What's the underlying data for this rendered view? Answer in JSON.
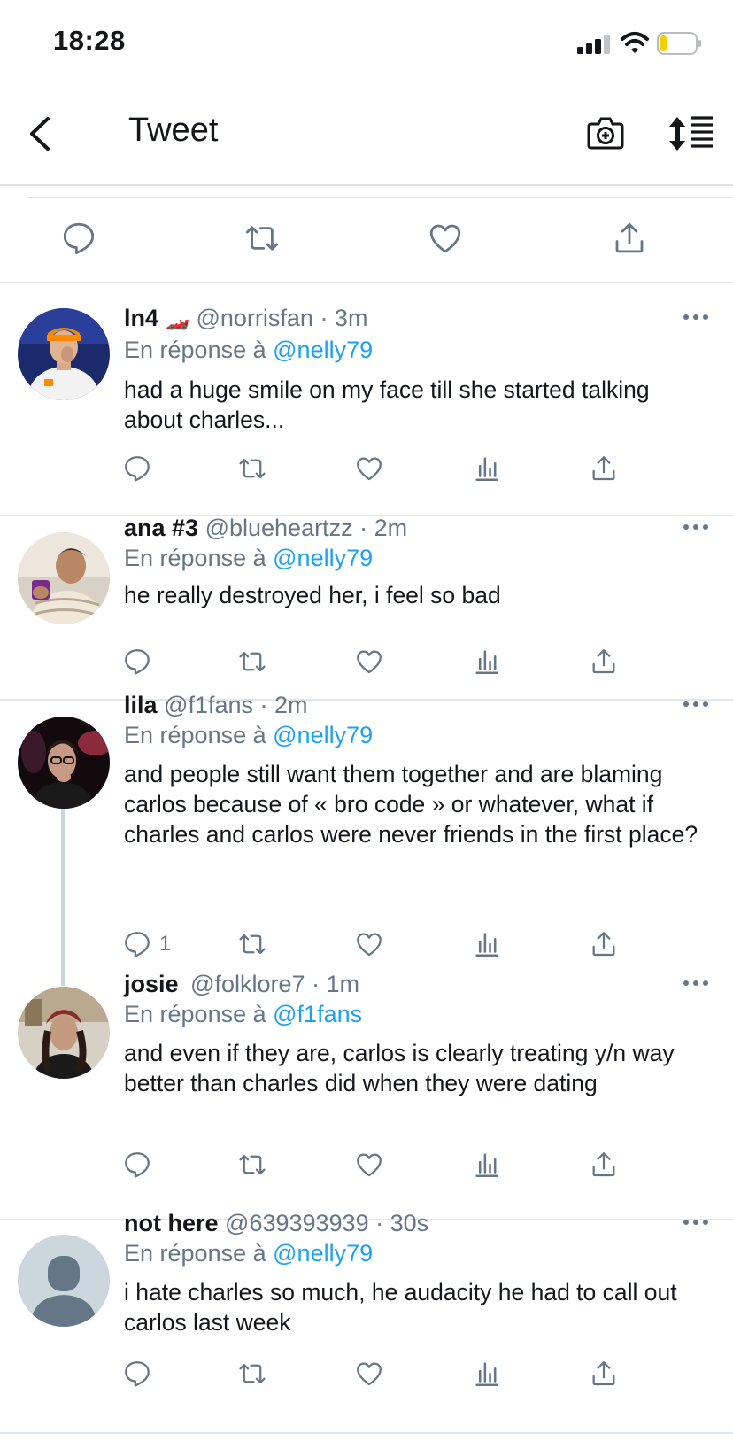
{
  "status_bar": {
    "time": "18:28"
  },
  "nav": {
    "title": "Tweet"
  },
  "replies": [
    {
      "name": "ln4",
      "emoji": "🏎️",
      "handle": "@norrisfan",
      "time": "· 3m",
      "reply_prefix": "En réponse à",
      "reply_to": "@nelly79",
      "text": "had a huge smile on my face till she started talking about charles...",
      "reply_count": ""
    },
    {
      "name": "ana #3",
      "emoji": "",
      "handle": "@blueheartzz",
      "time": "· 2m",
      "reply_prefix": "En réponse à",
      "reply_to": "@nelly79",
      "text": "he really destroyed her, i feel so bad",
      "reply_count": ""
    },
    {
      "name": "lila",
      "emoji": "",
      "handle": "@f1fans",
      "time": "· 2m",
      "reply_prefix": "En réponse à",
      "reply_to": "@nelly79",
      "text": "and people still want them together and are blaming carlos because of « bro code » or whatever, what if charles and carlos were never friends in the first place?",
      "reply_count": "1"
    },
    {
      "name": "josie",
      "emoji": "",
      "handle": "@folklore7",
      "time": "· 1m",
      "reply_prefix": "En réponse à",
      "reply_to": "@f1fans",
      "text": "and even if they are, carlos is clearly treating y/n way better than charles did when they were dating",
      "reply_count": ""
    },
    {
      "name": "not here",
      "emoji": "",
      "handle": "@639393939",
      "time": "· 30s",
      "reply_prefix": "En réponse à",
      "reply_to": "@nelly79",
      "text": "i hate charles so much, he audacity he had to call out carlos last week",
      "reply_count": ""
    }
  ],
  "icons": {
    "reply": "reply-icon",
    "retweet": "retweet-icon",
    "like": "heart-icon",
    "analytics": "analytics-icon",
    "share": "share-icon",
    "more": "more-icon"
  },
  "colors": {
    "accent": "#1da1f2",
    "secondary_text": "#657786",
    "divider": "#e1e8ed"
  }
}
